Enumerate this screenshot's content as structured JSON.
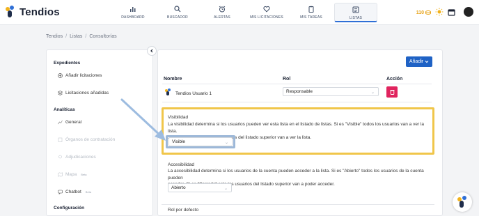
{
  "app": {
    "name": "Tendios"
  },
  "nav": [
    {
      "label": "DASHBOARD",
      "icon": "bar-chart-icon"
    },
    {
      "label": "BUSCADOR",
      "icon": "search-icon"
    },
    {
      "label": "ALERTAS",
      "icon": "alarm-clock-icon"
    },
    {
      "label": "MIS LICITACIONES",
      "icon": "heart-icon"
    },
    {
      "label": "MIS TAREAS",
      "icon": "clipboard-icon"
    },
    {
      "label": "LISTAS",
      "icon": "list-icon",
      "active": true
    }
  ],
  "top_right": {
    "credits": "110"
  },
  "breadcrumb": [
    "Tendios",
    "Listas",
    "Consultorías"
  ],
  "sidebar": {
    "section_expedientes": "Expedientes",
    "item_add": "Añadir licitaciones",
    "item_added": "Licitaciones añadidas",
    "section_analiticas": "Analíticas",
    "item_general": "General",
    "item_organos": "Órganos de contratación",
    "item_adjudicaciones": "Adjudicaciones",
    "item_mapa": "Mapa",
    "item_mapa_badge": "Beta",
    "item_chatbot": "Chatbot",
    "item_chatbot_badge": "Beta",
    "section_config": "Configuración"
  },
  "main": {
    "add_button": "Añadir",
    "table": {
      "col_nombre": "Nombre",
      "col_rol": "Rol",
      "col_accion": "Acción",
      "user_name": "Tendios Usuario 1",
      "user_role": "Responsable"
    },
    "visibilidad": {
      "title": "Visibilidad",
      "desc_line1": "La visibilidad determina si los usuarios pueden ver esta lista en el listado de listas. Si es \"Visible\" todos los usuarios van a ver la lista.",
      "desc_line2": "Si es \"No visible\" solo los usuarios del listado superior van a ver la lista.",
      "value": "Visible"
    },
    "accesibilidad": {
      "title": "Accesibilidad",
      "desc_line1": "La accesibilidad determina si los usuarios de la cuenta pueden acceder a la lista. Si es \"Abierto\" todos los usuarios de la cuenta pueden",
      "desc_line2": "acceder. Si es \"Cerrado\" solo los usuarios del listado superior van a poder acceder.",
      "value": "Abierto"
    },
    "rol_defecto": {
      "title": "Rol por defecto"
    }
  },
  "colors": {
    "accent": "#1f62c5",
    "highlight": "#f0c64a",
    "delete": "#e0245e"
  }
}
